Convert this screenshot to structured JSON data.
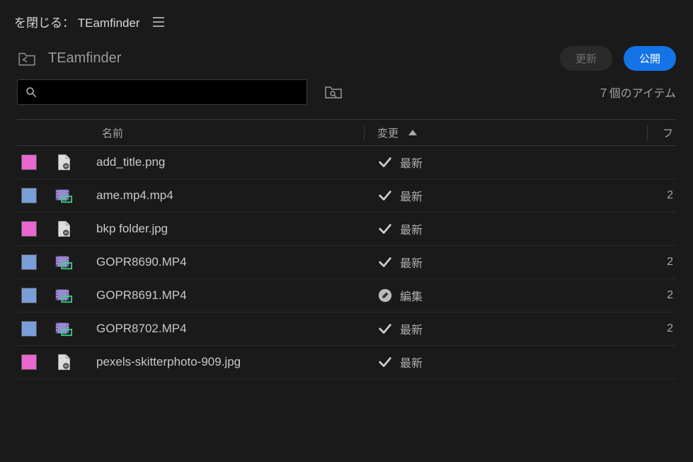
{
  "header": {
    "close_prefix": "を閉じる：",
    "project_name": "TEamfinder"
  },
  "toolbar": {
    "breadcrumb": "TEamfinder",
    "refresh_label": "更新",
    "publish_label": "公開"
  },
  "search": {
    "placeholder": ""
  },
  "item_count_text": "７個のアイテム",
  "columns": {
    "name": "名前",
    "modified": "変更",
    "extra": "フ"
  },
  "status_labels": {
    "latest": "最新",
    "edit": "編集"
  },
  "rows": [
    {
      "color": "pink",
      "type": "image",
      "name": "add_title.png",
      "status": "latest",
      "extra": ""
    },
    {
      "color": "blue",
      "type": "video",
      "name": "ame.mp4.mp4",
      "status": "latest",
      "extra": "2"
    },
    {
      "color": "pink",
      "type": "image",
      "name": "bkp folder.jpg",
      "status": "latest",
      "extra": ""
    },
    {
      "color": "blue",
      "type": "video",
      "name": "GOPR8690.MP4",
      "status": "latest",
      "extra": "2"
    },
    {
      "color": "blue",
      "type": "video",
      "name": "GOPR8691.MP4",
      "status": "edit",
      "extra": "2"
    },
    {
      "color": "blue",
      "type": "video",
      "name": "GOPR8702.MP4",
      "status": "latest",
      "extra": "2"
    },
    {
      "color": "pink",
      "type": "image",
      "name": "pexels-skitterphoto-909.jpg",
      "status": "latest",
      "extra": ""
    }
  ]
}
